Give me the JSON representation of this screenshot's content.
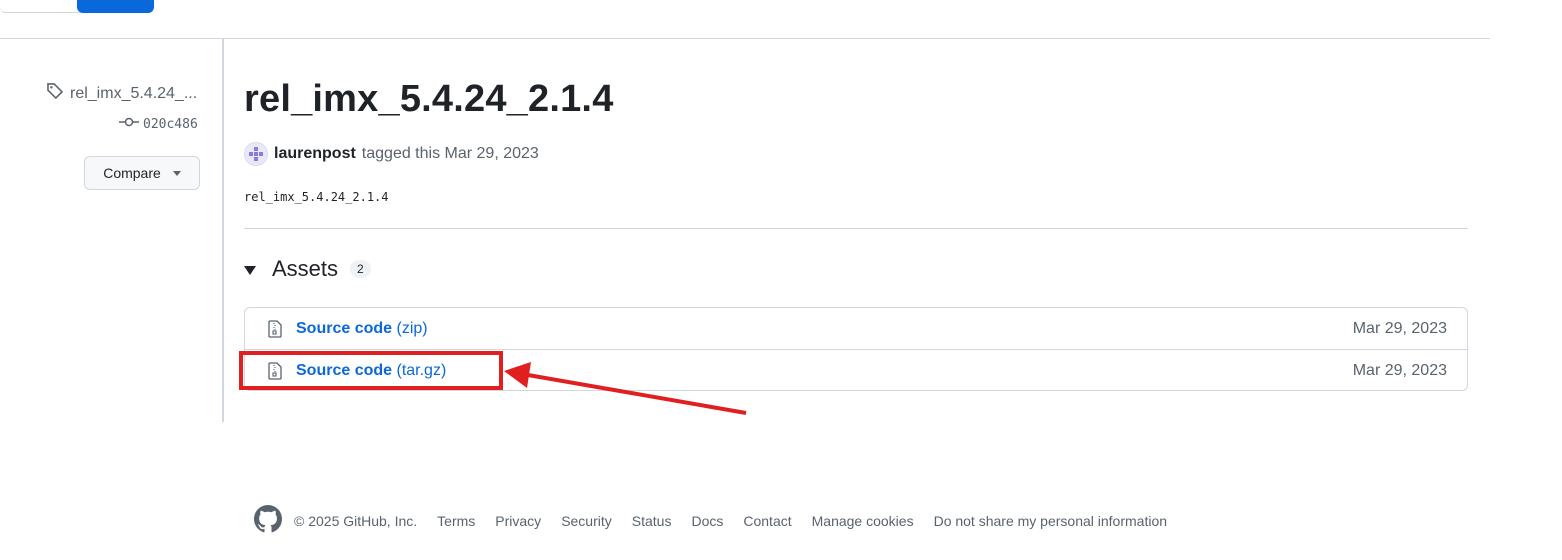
{
  "sidebar": {
    "tag_name": "rel_imx_5.4.24_...",
    "commit": "020c486",
    "compare_label": "Compare"
  },
  "release": {
    "title": "rel_imx_5.4.24_2.1.4",
    "author": "laurenpost",
    "tagged_text": "tagged this Mar 29, 2023",
    "tag_code": "rel_imx_5.4.24_2.1.4"
  },
  "assets": {
    "heading": "Assets",
    "count": "2",
    "items": [
      {
        "name": "Source code",
        "ext": "(zip)",
        "date": "Mar 29, 2023"
      },
      {
        "name": "Source code",
        "ext": "(tar.gz)",
        "date": "Mar 29, 2023"
      }
    ]
  },
  "footer": {
    "copyright": "© 2025 GitHub, Inc.",
    "links": [
      "Terms",
      "Privacy",
      "Security",
      "Status",
      "Docs",
      "Contact",
      "Manage cookies",
      "Do not share my personal information"
    ]
  },
  "colors": {
    "link": "#0969da",
    "annotation": "#e02020",
    "border": "#d0d7de"
  }
}
